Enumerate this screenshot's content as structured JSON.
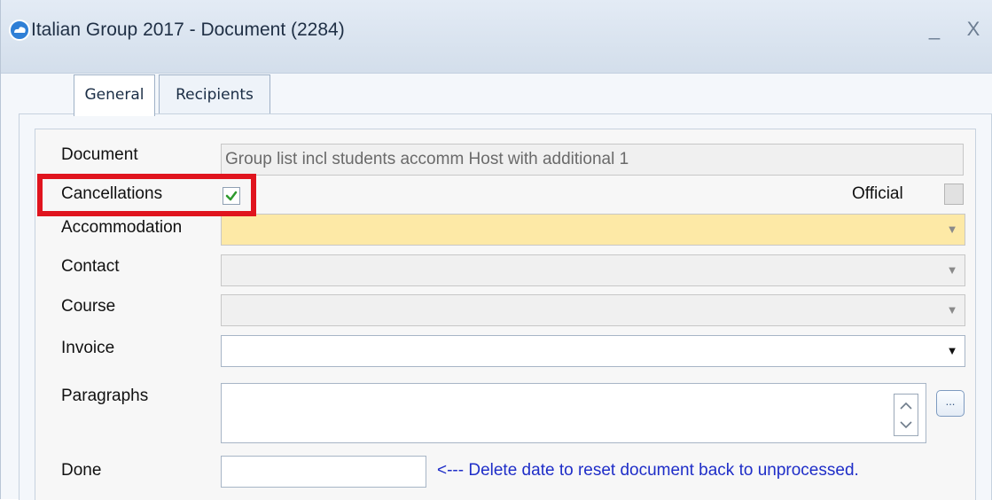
{
  "window": {
    "title": "Italian Group 2017 - Document (2284)",
    "minimize_label": "_",
    "close_label": "X"
  },
  "tabs": [
    {
      "label": "General",
      "active": true
    },
    {
      "label": "Recipients",
      "active": false
    }
  ],
  "form": {
    "document": {
      "label": "Document",
      "value": "Group list incl students accomm Host with additional 1"
    },
    "cancellations": {
      "label": "Cancellations",
      "checked": true
    },
    "official": {
      "label": "Official",
      "checked": false
    },
    "accommodation": {
      "label": "Accommodation",
      "value": ""
    },
    "contact": {
      "label": "Contact",
      "value": ""
    },
    "course": {
      "label": "Course",
      "value": ""
    },
    "invoice": {
      "label": "Invoice",
      "value": ""
    },
    "paragraphs": {
      "label": "Paragraphs",
      "value": "",
      "button_label": "..."
    },
    "done": {
      "label": "Done",
      "value": "",
      "hint": "<--- Delete date to reset document back to unprocessed."
    }
  },
  "colors": {
    "highlight_box": "#e0141e",
    "required_field": "#fde9a6",
    "hint_text": "#1f2ec8",
    "check_mark": "#2e9a2e"
  },
  "icons": {
    "app": "cloud-icon",
    "combo": "chevron-down-icon",
    "spin_up": "chevron-up-icon",
    "spin_down": "chevron-down-icon",
    "checked": "check-icon"
  }
}
